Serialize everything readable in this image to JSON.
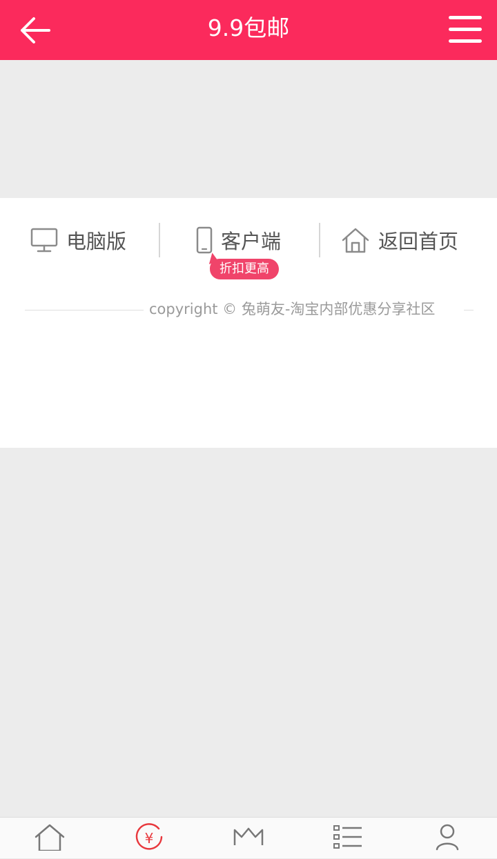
{
  "header": {
    "title": "9.9包邮",
    "back_icon": "arrow-left-icon",
    "menu_icon": "hamburger-menu-icon",
    "background_color": "#fb2a5c"
  },
  "footer_links": [
    {
      "label": "电脑版",
      "icon": "desktop-monitor-icon"
    },
    {
      "label": "客户端",
      "icon": "mobile-phone-icon"
    },
    {
      "label": "返回首页",
      "icon": "home-icon"
    }
  ],
  "badge": {
    "text": "折扣更高",
    "color": "#f0446a"
  },
  "copyright": "copyright © 兔萌友-淘宝内部优惠分享社区",
  "tabbar": {
    "tabs": [
      {
        "icon": "home-icon",
        "active": false
      },
      {
        "icon": "yen-coin-icon",
        "active": true
      },
      {
        "icon": "crown-icon",
        "active": false
      },
      {
        "icon": "category-list-icon",
        "active": false
      },
      {
        "icon": "user-profile-icon",
        "active": false
      }
    ],
    "active_color": "#e8383d",
    "inactive_color": "#666666"
  }
}
